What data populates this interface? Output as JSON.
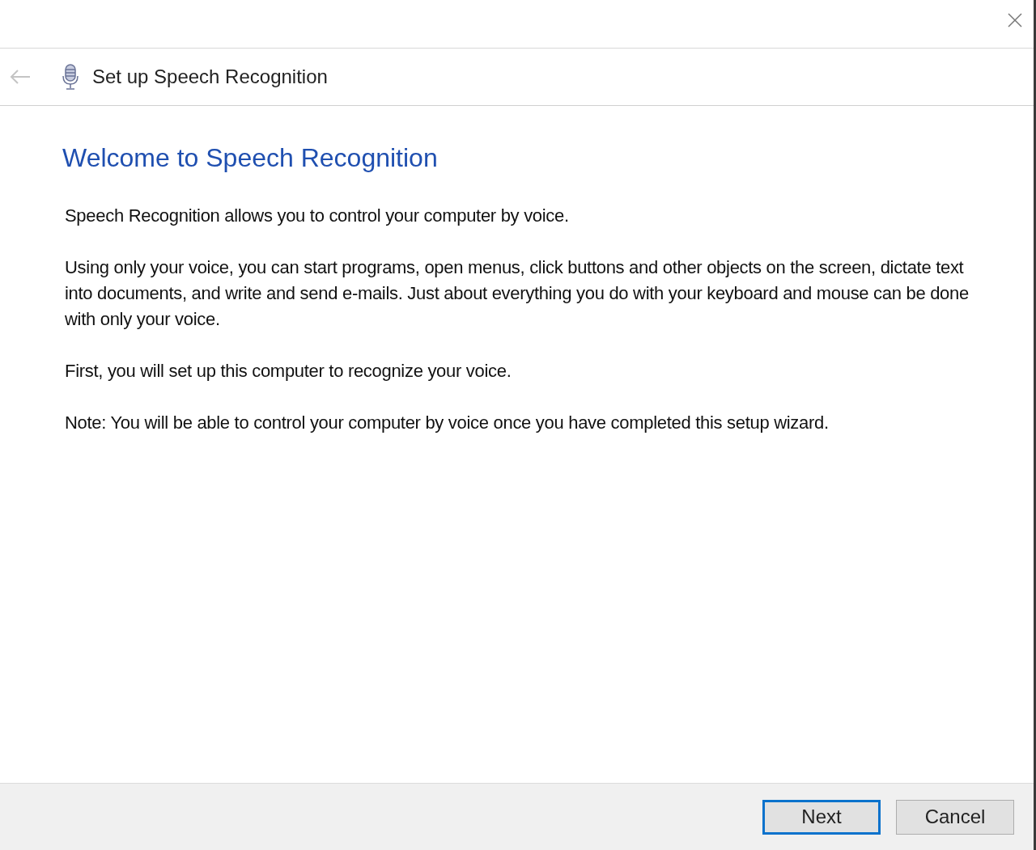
{
  "header": {
    "back_disabled": true,
    "title": "Set up Speech Recognition"
  },
  "heading": "Welcome to Speech Recognition",
  "paragraphs": [
    "Speech Recognition allows you to control your computer by voice.",
    "Using only your voice, you can start programs, open menus, click buttons and other objects on the screen, dictate text into documents, and write and send e-mails. Just about everything you do with your keyboard and mouse can be done with only your voice.",
    "First, you will set up this computer to recognize your voice.",
    "Note: You will be able to control your computer by voice once you have completed this setup wizard."
  ],
  "buttons": [
    {
      "label": "Next",
      "default": true
    },
    {
      "label": "Cancel",
      "default": false
    }
  ]
}
